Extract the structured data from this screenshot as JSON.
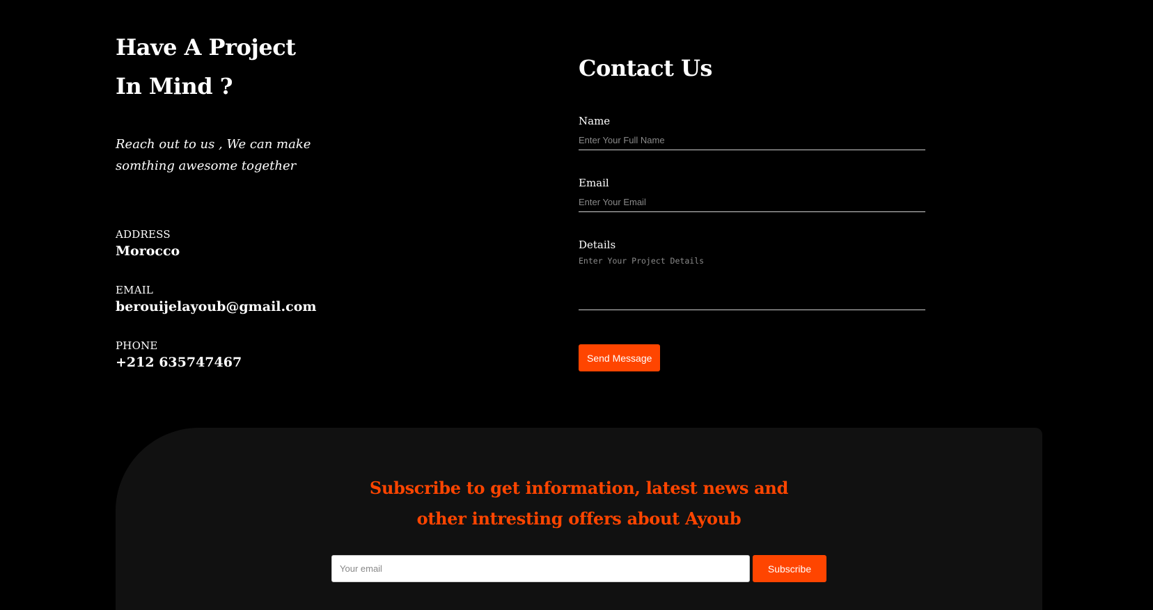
{
  "project": {
    "headline_line1": "Have A Project",
    "headline_line2": "In Mind ?",
    "tagline": "Reach out to us , We can make somthing awesome together"
  },
  "info": {
    "address_label": "ADDRESS",
    "address_value": "Morocco",
    "email_label": "EMAIL",
    "email_value": "berouijelayoub@gmail.com",
    "phone_label": "PHONE",
    "phone_value": "+212 635747467"
  },
  "contact": {
    "title": "Contact Us",
    "name_label": "Name",
    "name_placeholder": "Enter Your Full Name",
    "email_label": "Email",
    "email_placeholder": "Enter Your Email",
    "details_label": "Details",
    "details_placeholder": "Enter Your Project Details",
    "send_label": "Send Message"
  },
  "newsletter": {
    "title": "Subscribe to get information, latest news and other intresting offers about Ayoub",
    "input_placeholder": "Your email",
    "subscribe_label": "Subscribe"
  },
  "colors": {
    "accent": "#ff4500",
    "background": "#000000",
    "panel": "#111111"
  }
}
